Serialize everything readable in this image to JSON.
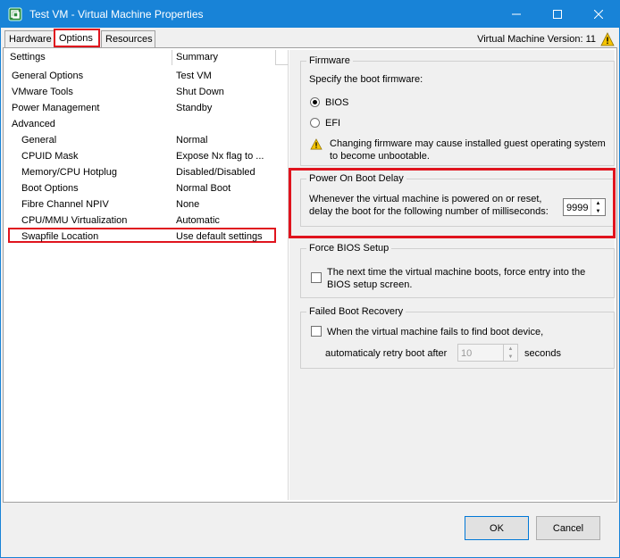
{
  "window": {
    "title": "Test VM - Virtual Machine Properties",
    "accent_color": "#1883d7",
    "highlight_color": "#e0141e"
  },
  "tabs": [
    {
      "label": "Hardware"
    },
    {
      "label": "Options"
    },
    {
      "label": "Resources"
    }
  ],
  "vm_version": "Virtual Machine Version: 11",
  "list": {
    "headers": {
      "settings": "Settings",
      "summary": "Summary"
    },
    "rows": [
      {
        "setting": "General Options",
        "summary": "Test VM"
      },
      {
        "setting": "VMware Tools",
        "summary": "Shut Down"
      },
      {
        "setting": "Power Management",
        "summary": "Standby"
      },
      {
        "setting": "Advanced",
        "summary": ""
      },
      {
        "setting": "General",
        "summary": "Normal"
      },
      {
        "setting": "CPUID Mask",
        "summary": "Expose Nx flag to ..."
      },
      {
        "setting": "Memory/CPU Hotplug",
        "summary": "Disabled/Disabled"
      },
      {
        "setting": "Boot Options",
        "summary": "Normal Boot"
      },
      {
        "setting": "Fibre Channel NPIV",
        "summary": "None"
      },
      {
        "setting": "CPU/MMU Virtualization",
        "summary": "Automatic"
      },
      {
        "setting": "Swapfile Location",
        "summary": "Use default settings"
      }
    ]
  },
  "firmware": {
    "title": "Firmware",
    "prompt": "Specify the boot firmware:",
    "bios": "BIOS",
    "efi": "EFI",
    "selected": "BIOS",
    "warning_line1": "Changing firmware may cause installed guest operating system",
    "warning_line2": "to become unbootable."
  },
  "boot_delay": {
    "title": "Power On Boot Delay",
    "line1": "Whenever the virtual machine is powered on or reset,",
    "line2": "delay the boot for the following number of milliseconds:",
    "value": "9999"
  },
  "force_bios": {
    "title": "Force BIOS Setup",
    "line1": "The next time the virtual machine boots, force entry into the",
    "line2": "BIOS setup screen.",
    "checked": false
  },
  "failed_boot": {
    "title": "Failed Boot Recovery",
    "line1": "When the virtual machine fails to find boot device,",
    "retry_label": "automaticaly retry boot after",
    "retry_value": "10",
    "unit": "seconds",
    "checked": false
  },
  "buttons": {
    "ok": "OK",
    "cancel": "Cancel"
  }
}
